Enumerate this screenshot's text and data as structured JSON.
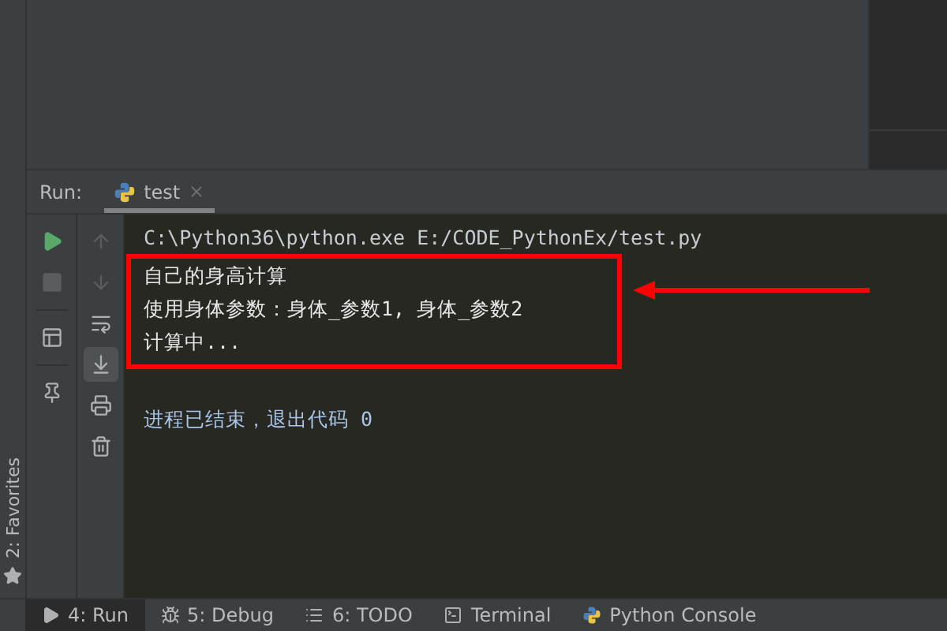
{
  "side_strip": {
    "label": "2: Favorites"
  },
  "run_panel": {
    "title": "Run:",
    "tabs": [
      {
        "label": "test",
        "selected": true
      }
    ]
  },
  "run_toolbar": [
    {
      "kind": "run",
      "disabled": false
    },
    {
      "kind": "stop",
      "disabled": true
    },
    {
      "kind": "layout",
      "disabled": false
    },
    {
      "kind": "pin",
      "disabled": false
    }
  ],
  "console_toolbar": [
    {
      "kind": "up",
      "disabled": true,
      "on": false
    },
    {
      "kind": "down",
      "disabled": true,
      "on": false
    },
    {
      "kind": "wrap",
      "disabled": false,
      "on": false
    },
    {
      "kind": "scroll-end",
      "disabled": false,
      "on": true
    },
    {
      "kind": "print",
      "disabled": false,
      "on": false
    },
    {
      "kind": "trash",
      "disabled": false,
      "on": false
    }
  ],
  "console": [
    {
      "kind": "command",
      "text": "C:\\Python36\\python.exe E:/CODE_PythonEx/test.py",
      "highlighted": false
    },
    {
      "kind": "output",
      "text": "自己的身高计算",
      "highlighted": true
    },
    {
      "kind": "output",
      "text": "使用身体参数：身体_参数1, 身体_参数2",
      "highlighted": true
    },
    {
      "kind": "output",
      "text": "计算中...",
      "highlighted": true
    },
    {
      "kind": "exit",
      "text": "进程已结束，退出代码 0",
      "highlighted": false
    }
  ],
  "bottom_tabs": [
    {
      "kind": "run",
      "label": "4: Run",
      "selected": true
    },
    {
      "kind": "debug",
      "label": "5: Debug",
      "selected": false
    },
    {
      "kind": "todo",
      "label": "6: TODO",
      "selected": false
    },
    {
      "kind": "terminal",
      "label": "Terminal",
      "selected": false
    },
    {
      "kind": "python",
      "label": "Python Console",
      "selected": false
    }
  ]
}
